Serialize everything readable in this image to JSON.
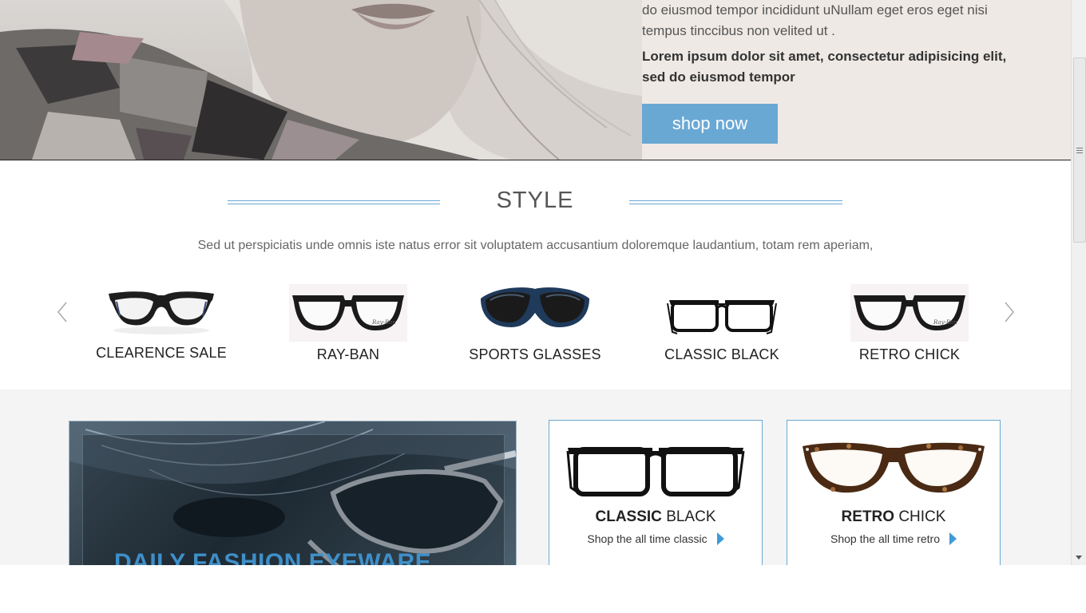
{
  "hero": {
    "paragraph": "do eiusmod tempor incididunt uNullam eget eros eget nisi tempus tinccibus non velited ut .",
    "bold_text": "Lorem ipsum dolor sit amet, consectetur adipisicing elit, sed do eiusmod tempor",
    "shop_button": "shop now"
  },
  "style_section": {
    "title": "STYLE",
    "subtitle": "Sed ut perspiciatis unde omnis iste natus error sit voluptatem accusantium doloremque laudantium, totam rem aperiam,",
    "categories": [
      {
        "label": "CLEARENCE SALE"
      },
      {
        "label": "RAY-BAN"
      },
      {
        "label": "SPORTS GLASSES"
      },
      {
        "label": "CLASSIC BLACK"
      },
      {
        "label": "RETRO CHICK"
      }
    ]
  },
  "promo": {
    "title": "DAILY FASHION EYEWARE"
  },
  "cards": [
    {
      "title_bold": "CLASSIC",
      "title_rest": "BLACK",
      "link": "Shop the all time classic"
    },
    {
      "title_bold": "RETRO",
      "title_rest": "CHICK",
      "link": "Shop the all time retro"
    }
  ],
  "colors": {
    "accent": "#6aa8d4",
    "link_arrow": "#3f9ad8",
    "hero_bg": "#eee9e5",
    "lower_bg": "#f4f4f4"
  }
}
